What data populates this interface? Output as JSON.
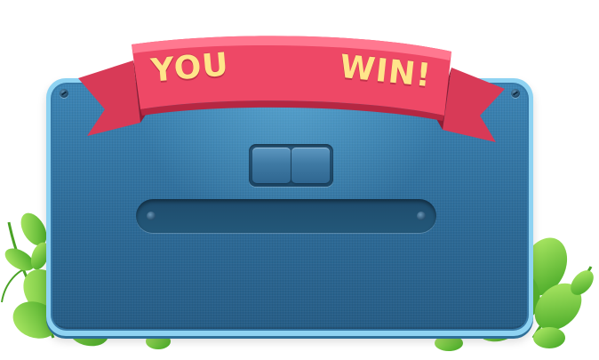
{
  "banner": {
    "word1": "YOU",
    "word2": "WIN!"
  },
  "colors": {
    "ribbon": "#e8405f",
    "ribbon_dark": "#b02440",
    "text": "#ffe58a",
    "panel": "#2f6d9b",
    "panel_border": "#8fd3f2",
    "leaf": "#6cc63a"
  },
  "controls": {
    "toggle_button_icon": "pause-icon",
    "progress": 0
  }
}
